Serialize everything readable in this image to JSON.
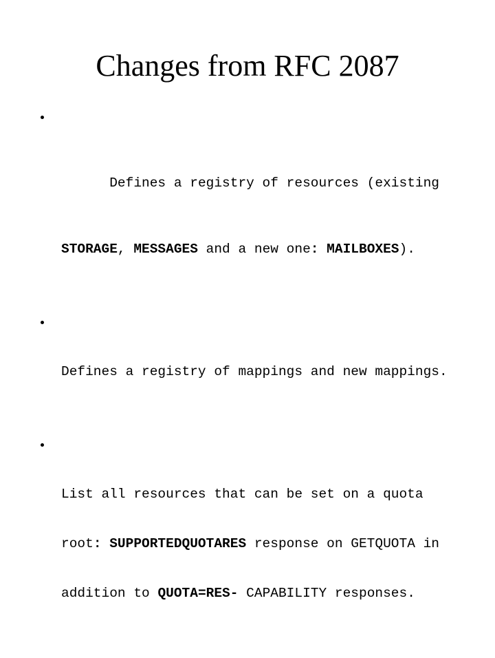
{
  "slide": {
    "title": "Changes from RFC 2087",
    "bullets": [
      {
        "lines": [
          [
            {
              "text": "Defines a registry of resources (existing",
              "bold": false
            }
          ],
          [
            {
              "text": "STORAGE",
              "bold": true
            },
            {
              "text": ", ",
              "bold": false
            },
            {
              "text": "MESSAGES",
              "bold": true
            },
            {
              "text": " and a new one",
              "bold": false
            },
            {
              "text": ": MAILBOXES",
              "bold": true
            },
            {
              "text": ").",
              "bold": false
            }
          ]
        ]
      },
      {
        "lines": [
          [
            {
              "text": "Defines a registry of mappings and new mappings.",
              "bold": false
            }
          ]
        ]
      },
      {
        "lines": [
          [
            {
              "text": "List all resources that can be set on a quota",
              "bold": false
            }
          ],
          [
            {
              "text": "root",
              "bold": false
            },
            {
              "text": ": SUPPORTEDQUOTARES",
              "bold": true
            },
            {
              "text": " response on GETQUOTA in",
              "bold": false
            }
          ],
          [
            {
              "text": "addition to ",
              "bold": false
            },
            {
              "text": "QUOTA=RES-",
              "bold": true
            },
            {
              "text": " CAPABILITY responses.",
              "bold": false
            }
          ]
        ]
      }
    ]
  }
}
